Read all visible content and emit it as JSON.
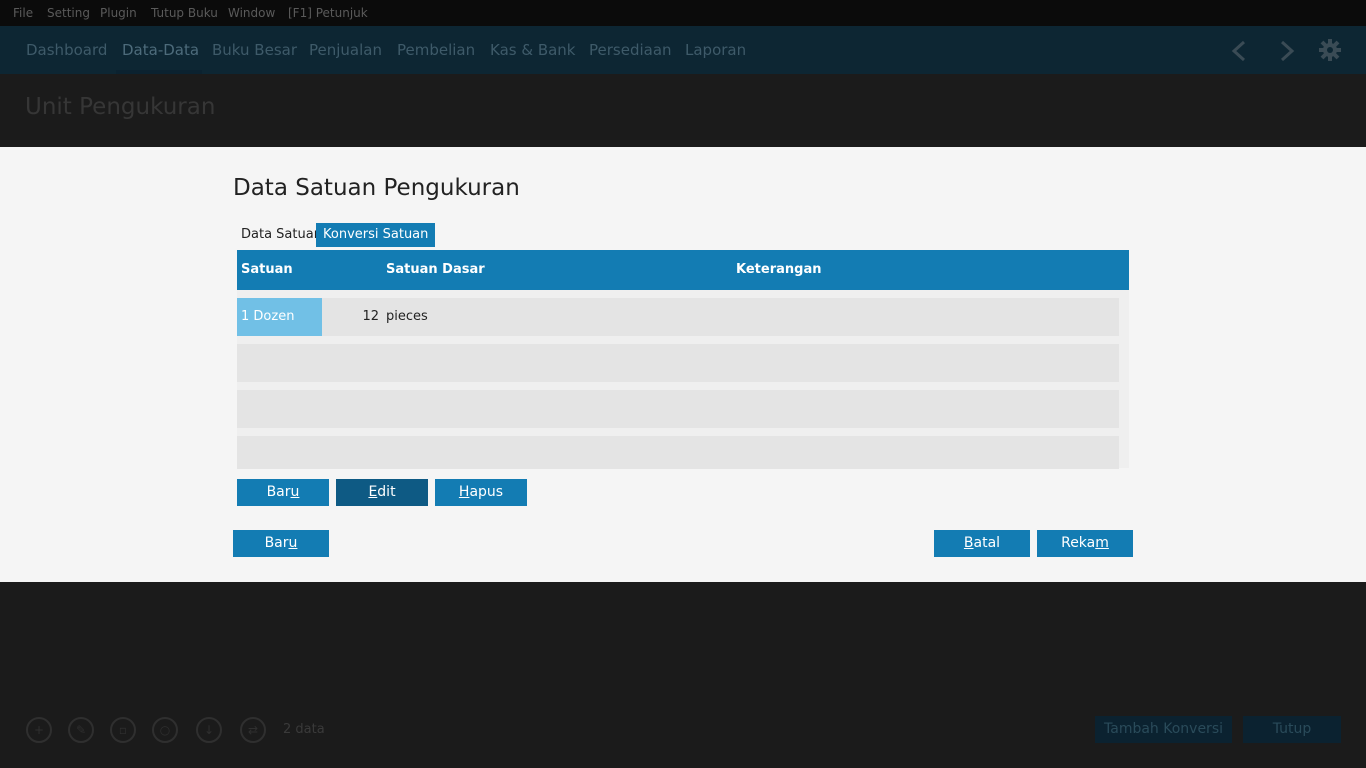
{
  "menu": [
    "File",
    "Setting",
    "Plugin",
    "Tutup Buku",
    "Window",
    "[F1] Petunjuk"
  ],
  "nav": [
    "Dashboard",
    "Data-Data",
    "Buku Besar",
    "Penjualan",
    "Pembelian",
    "Kas & Bank",
    "Persediaan",
    "Laporan"
  ],
  "nav_active": "Data-Data",
  "nav_icons": [
    "chevron-left-icon",
    "chevron-right-icon",
    "gear-icon"
  ],
  "background": {
    "page_title": "Unit Pengukuran",
    "record_count": "2 data",
    "bottom_icons": [
      "add-icon",
      "edit-icon",
      "delete-icon",
      "refresh-icon",
      "download-icon",
      "sync-icon"
    ],
    "buttons": [
      "Tambah Konversi",
      "Tutup"
    ]
  },
  "modal": {
    "title": "Data Satuan Pengukuran",
    "tabs": [
      "Data Satuan",
      "Konversi Satuan"
    ],
    "active_tab": "Konversi Satuan",
    "grid": {
      "columns": [
        "Satuan",
        "Satuan Dasar",
        "Keterangan"
      ],
      "rows": [
        {
          "satuan": "1 Dozen",
          "jumlah": "12",
          "satuan_dasar": "pieces",
          "keterangan": ""
        }
      ]
    },
    "grid_buttons": [
      {
        "pre": "Bar",
        "key": "u",
        "post": ""
      },
      {
        "pre": "",
        "key": "E",
        "post": "dit"
      },
      {
        "pre": "",
        "key": "H",
        "post": "apus"
      }
    ],
    "footer_buttons": {
      "new": {
        "pre": "Bar",
        "key": "u",
        "post": ""
      },
      "cancel": {
        "pre": "",
        "key": "B",
        "post": "atal"
      },
      "save": {
        "pre": "Reka",
        "key": "m",
        "post": ""
      }
    }
  },
  "colors": {
    "accent": "#137cb3",
    "accent_dark": "#0e5a84",
    "selected_cell": "#71c0e6"
  }
}
